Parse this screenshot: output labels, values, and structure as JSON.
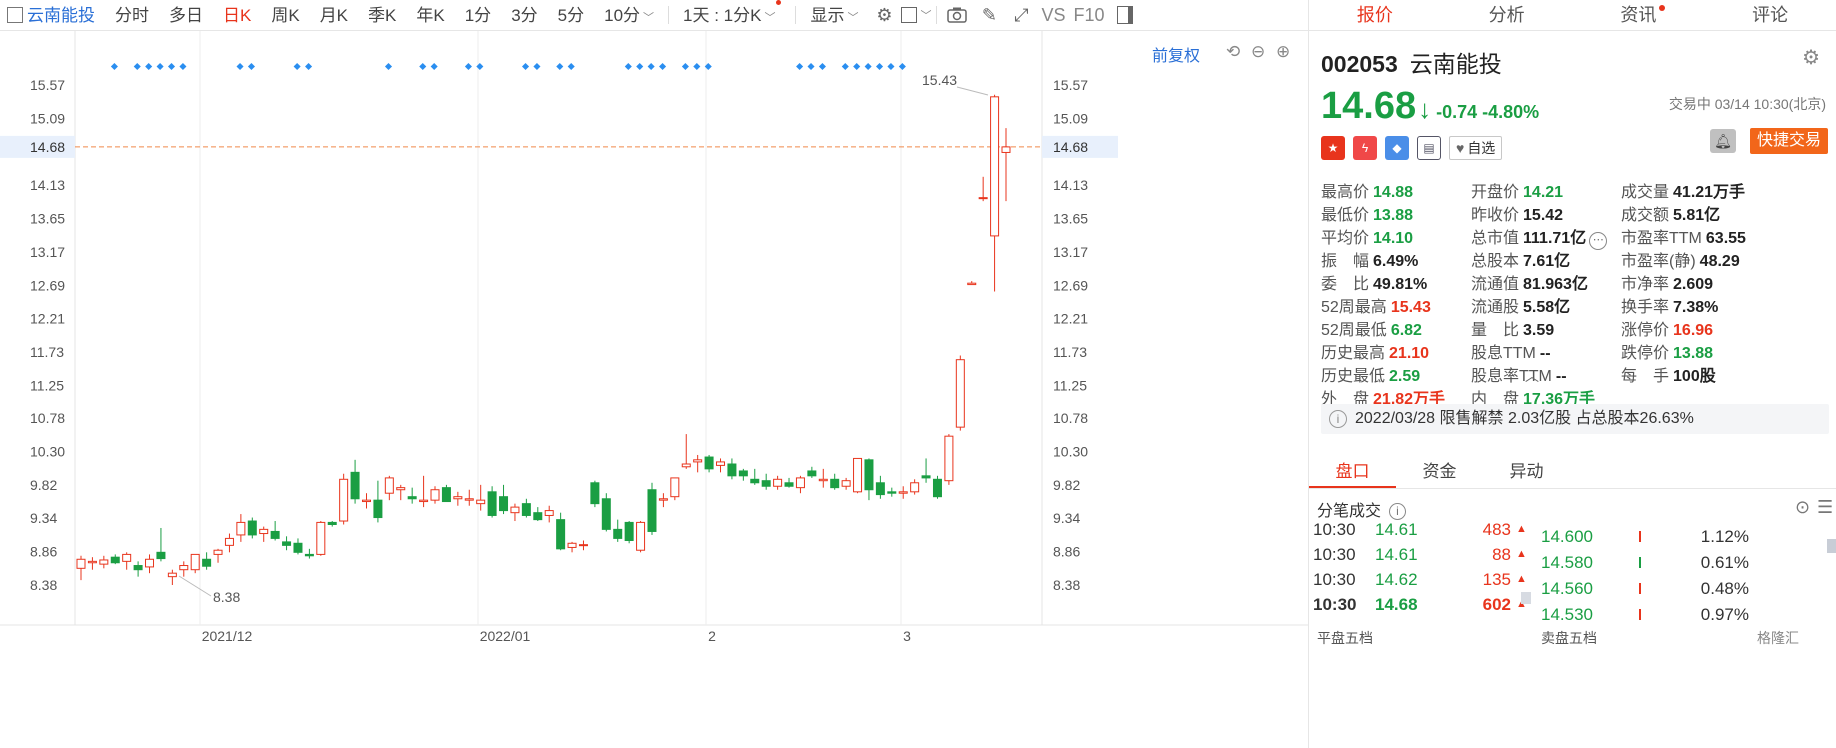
{
  "toolbar": {
    "stock_name": "云南能投",
    "periods": [
      "分时",
      "多日",
      "日K",
      "周K",
      "月K",
      "季K",
      "年K",
      "1分",
      "3分",
      "5分",
      "10分"
    ],
    "active_period": "日K",
    "interval_select": "1天 : 1分K",
    "display_label": "显示",
    "vs_label": "VS",
    "f10_label": "F10"
  },
  "chart": {
    "adjust_label": "前复权",
    "y_ticks": [
      "15.57",
      "15.09",
      "14.68",
      "14.13",
      "13.65",
      "13.17",
      "12.69",
      "12.21",
      "11.73",
      "11.25",
      "10.78",
      "10.30",
      "9.82",
      "9.34",
      "8.86",
      "8.38"
    ],
    "current_price_label": "14.68",
    "x_ticks": [
      "2021/12",
      "2022/01",
      "2",
      "3"
    ],
    "high_label": "15.43",
    "low_label": "8.38",
    "up_color": "#e8341c",
    "down_color": "#1a9e43"
  },
  "chart_data": {
    "type": "candlestick",
    "title": "",
    "ylim": [
      8.1,
      15.75
    ],
    "x_labels": [
      "2021/12",
      "2022/01",
      "2",
      "3"
    ],
    "ohlc": [
      [
        8.62,
        8.8,
        8.45,
        8.75
      ],
      [
        8.7,
        8.78,
        8.6,
        8.72
      ],
      [
        8.68,
        8.8,
        8.62,
        8.74
      ],
      [
        8.78,
        8.82,
        8.68,
        8.7
      ],
      [
        8.72,
        8.85,
        8.6,
        8.82
      ],
      [
        8.66,
        8.72,
        8.5,
        8.6
      ],
      [
        8.64,
        8.82,
        8.55,
        8.75
      ],
      [
        8.85,
        9.2,
        8.72,
        8.76
      ],
      [
        8.5,
        8.6,
        8.38,
        8.55
      ],
      [
        8.6,
        8.72,
        8.5,
        8.66
      ],
      [
        8.6,
        8.82,
        8.55,
        8.82
      ],
      [
        8.75,
        8.85,
        8.6,
        8.65
      ],
      [
        8.82,
        8.9,
        8.7,
        8.88
      ],
      [
        8.95,
        9.12,
        8.85,
        9.05
      ],
      [
        9.1,
        9.4,
        9.0,
        9.28
      ],
      [
        9.3,
        9.35,
        9.05,
        9.1
      ],
      [
        9.12,
        9.22,
        9.0,
        9.18
      ],
      [
        9.15,
        9.3,
        9.02,
        9.05
      ],
      [
        9.0,
        9.08,
        8.88,
        8.95
      ],
      [
        8.98,
        9.05,
        8.82,
        8.85
      ],
      [
        8.82,
        8.9,
        8.76,
        8.8
      ],
      [
        8.82,
        9.3,
        8.8,
        9.28
      ],
      [
        9.28,
        9.3,
        9.22,
        9.25
      ],
      [
        9.3,
        9.98,
        9.25,
        9.9
      ],
      [
        10.0,
        10.18,
        9.55,
        9.62
      ],
      [
        9.58,
        9.7,
        9.48,
        9.6
      ],
      [
        9.6,
        9.88,
        9.28,
        9.35
      ],
      [
        9.7,
        9.95,
        9.6,
        9.92
      ],
      [
        9.75,
        9.82,
        9.6,
        9.78
      ],
      [
        9.65,
        9.78,
        9.55,
        9.62
      ],
      [
        9.58,
        9.95,
        9.5,
        9.6
      ],
      [
        9.6,
        9.8,
        9.55,
        9.75
      ],
      [
        9.78,
        9.82,
        9.58,
        9.58
      ],
      [
        9.62,
        9.72,
        9.52,
        9.65
      ],
      [
        9.6,
        9.75,
        9.52,
        9.62
      ],
      [
        9.55,
        9.82,
        9.45,
        9.6
      ],
      [
        9.72,
        9.8,
        9.35,
        9.38
      ],
      [
        9.65,
        9.82,
        9.4,
        9.45
      ],
      [
        9.42,
        9.55,
        9.3,
        9.5
      ],
      [
        9.55,
        9.62,
        9.35,
        9.38
      ],
      [
        9.42,
        9.5,
        9.3,
        9.32
      ],
      [
        9.38,
        9.52,
        9.28,
        9.45
      ],
      [
        9.32,
        9.42,
        8.88,
        8.9
      ],
      [
        8.92,
        9.0,
        8.85,
        8.98
      ],
      [
        8.95,
        9.02,
        8.88,
        8.96
      ],
      [
        9.85,
        9.88,
        9.5,
        9.55
      ],
      [
        9.62,
        9.7,
        9.15,
        9.18
      ],
      [
        9.18,
        9.32,
        9.0,
        9.05
      ],
      [
        9.28,
        9.3,
        8.98,
        9.02
      ],
      [
        8.88,
        9.3,
        8.85,
        9.28
      ],
      [
        9.75,
        9.85,
        9.1,
        9.15
      ],
      [
        9.6,
        9.7,
        9.5,
        9.62
      ],
      [
        9.65,
        9.92,
        9.6,
        9.92
      ],
      [
        10.08,
        10.55,
        10.05,
        10.12
      ],
      [
        10.15,
        10.25,
        10.0,
        10.18
      ],
      [
        10.22,
        10.25,
        10.0,
        10.05
      ],
      [
        10.1,
        10.2,
        10.0,
        10.15
      ],
      [
        10.12,
        10.2,
        9.9,
        9.95
      ],
      [
        10.02,
        10.05,
        9.88,
        9.95
      ],
      [
        9.9,
        10.05,
        9.82,
        9.85
      ],
      [
        9.88,
        9.98,
        9.75,
        9.8
      ],
      [
        9.8,
        9.95,
        9.75,
        9.9
      ],
      [
        9.85,
        9.92,
        9.78,
        9.8
      ],
      [
        9.78,
        9.95,
        9.7,
        9.92
      ],
      [
        10.02,
        10.08,
        9.92,
        9.95
      ],
      [
        9.88,
        10.05,
        9.78,
        9.9
      ],
      [
        9.9,
        9.98,
        9.75,
        9.78
      ],
      [
        9.8,
        9.92,
        9.75,
        9.88
      ],
      [
        9.72,
        10.2,
        9.7,
        10.2
      ],
      [
        10.18,
        10.2,
        9.6,
        9.75
      ],
      [
        9.85,
        9.95,
        9.62,
        9.68
      ],
      [
        9.72,
        9.78,
        9.65,
        9.7
      ],
      [
        9.7,
        9.8,
        9.62,
        9.72
      ],
      [
        9.72,
        9.9,
        9.68,
        9.85
      ],
      [
        9.95,
        10.2,
        9.85,
        9.92
      ],
      [
        9.9,
        9.95,
        9.62,
        9.65
      ],
      [
        9.88,
        10.55,
        9.82,
        10.52
      ],
      [
        10.65,
        11.68,
        10.6,
        11.62
      ],
      [
        12.7,
        12.75,
        12.7,
        12.72
      ],
      [
        13.95,
        14.25,
        13.9,
        13.95
      ],
      [
        13.4,
        15.43,
        12.6,
        15.4
      ],
      [
        14.6,
        14.95,
        13.9,
        14.68
      ]
    ],
    "dots": [
      1,
      3,
      4,
      5,
      6,
      7,
      12,
      13,
      17,
      18,
      25,
      28,
      29,
      32,
      33,
      37,
      38,
      40,
      41,
      46,
      47,
      48,
      49,
      51,
      52,
      53,
      61,
      62,
      63,
      65,
      66,
      67,
      68,
      69,
      70
    ]
  },
  "panel": {
    "tabs": [
      "报价",
      "分析",
      "资讯",
      "评论"
    ],
    "active_tab": "报价",
    "code": "002053",
    "name": "云南能投",
    "price": "14.68",
    "change": "-0.74",
    "change_pct": "-4.80%",
    "status": "交易中 03/14 10:30(北京)",
    "fav_label": "自选",
    "fast_trade_label": "快捷交易",
    "stats": [
      [
        {
          "l": "最高价",
          "v": "14.88",
          "c": "g"
        },
        {
          "l": "开盘价",
          "v": "14.21",
          "c": "g"
        },
        {
          "l": "成交量",
          "v": "41.21万手",
          "c": ""
        }
      ],
      [
        {
          "l": "最低价",
          "v": "13.88",
          "c": "g"
        },
        {
          "l": "昨收价",
          "v": "15.42",
          "c": ""
        },
        {
          "l": "成交额",
          "v": "5.81亿",
          "c": ""
        }
      ],
      [
        {
          "l": "平均价",
          "v": "14.10",
          "c": "g"
        },
        {
          "l": "总市值",
          "v": "111.71亿",
          "c": ""
        },
        {
          "l": "市盈率TTM",
          "v": "63.55",
          "c": ""
        }
      ],
      [
        {
          "l": "振　幅",
          "v": "6.49%",
          "c": ""
        },
        {
          "l": "总股本",
          "v": "7.61亿",
          "c": ""
        },
        {
          "l": "市盈率(静)",
          "v": "48.29",
          "c": ""
        }
      ],
      [
        {
          "l": "委　比",
          "v": "49.81%",
          "c": ""
        },
        {
          "l": "流通值",
          "v": "81.963亿",
          "c": ""
        },
        {
          "l": "市净率",
          "v": "2.609",
          "c": ""
        }
      ],
      [
        {
          "l": "52周最高",
          "v": "15.43",
          "c": "r"
        },
        {
          "l": "流通股",
          "v": "5.58亿",
          "c": ""
        },
        {
          "l": "换手率",
          "v": "7.38%",
          "c": ""
        }
      ],
      [
        {
          "l": "52周最低",
          "v": "6.82",
          "c": "g"
        },
        {
          "l": "量　比",
          "v": "3.59",
          "c": ""
        },
        {
          "l": "涨停价",
          "v": "16.96",
          "c": "r"
        }
      ],
      [
        {
          "l": "历史最高",
          "v": "21.10",
          "c": "r"
        },
        {
          "l": "股息TTM",
          "v": "--",
          "c": ""
        },
        {
          "l": "跌停价",
          "v": "13.88",
          "c": "g"
        }
      ],
      [
        {
          "l": "历史最低",
          "v": "2.59",
          "c": "g"
        },
        {
          "l": "股息率TTM",
          "v": "--",
          "c": ""
        },
        {
          "l": "每　手",
          "v": "100股",
          "c": ""
        }
      ],
      [
        {
          "l": "外　盘",
          "v": "21.82万手",
          "c": "r"
        },
        {
          "l": "内　盘",
          "v": "17.36万手",
          "c": "g"
        },
        {
          "l": "",
          "v": "",
          "c": ""
        }
      ]
    ],
    "notice": "2022/03/28  限售解禁 2.03亿股 占总股本26.63%",
    "sub_tabs": [
      "盘口",
      "资金",
      "异动"
    ],
    "active_sub_tab": "盘口",
    "trades_title": "分笔成交",
    "trades": [
      {
        "time": "10:30",
        "price": "14.61",
        "vol": "483"
      },
      {
        "time": "10:30",
        "price": "14.61",
        "vol": "88"
      },
      {
        "time": "10:30",
        "price": "14.62",
        "vol": "135"
      },
      {
        "time": "10:30",
        "price": "14.68",
        "vol": "602"
      }
    ],
    "levels": [
      {
        "price": "14.600",
        "pct": "1.12%"
      },
      {
        "price": "14.580",
        "pct": "0.61%"
      },
      {
        "price": "14.560",
        "pct": "0.48%"
      },
      {
        "price": "14.530",
        "pct": "0.97%"
      }
    ],
    "bottom_left": "平盘五档",
    "bottom_right": "卖盘五档",
    "watermark": "格隆汇"
  }
}
